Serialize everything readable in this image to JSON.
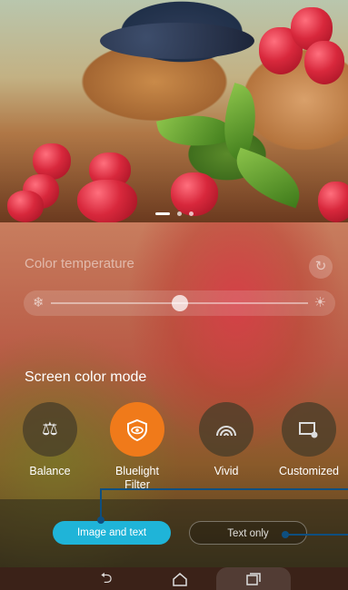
{
  "preview": {
    "icons": [
      "raspberry-photo",
      "page-indicator"
    ],
    "page_indicator_count": 3,
    "page_indicator_active": 0
  },
  "color_temperature": {
    "label": "Color temperature",
    "reset_icon": "refresh-icon",
    "cold_icon": "snowflake-icon",
    "warm_icon": "sun-icon",
    "slider_value": 0.5
  },
  "screen_color_mode": {
    "label": "Screen color mode",
    "modes": [
      {
        "label": "Balance",
        "icon": "balance-scale-icon",
        "selected": false
      },
      {
        "label": "Bluelight Filter",
        "icon": "eye-shield-icon",
        "selected": true
      },
      {
        "label": "Vivid",
        "icon": "rainbow-icon",
        "selected": false
      },
      {
        "label": "Customized",
        "icon": "custom-screen-icon",
        "selected": false
      }
    ]
  },
  "filter_options": {
    "active": "Image and text",
    "inactive": "Text only"
  },
  "colors": {
    "accent_orange": "#f07a1a",
    "accent_cyan": "#1fb4d8",
    "pointer": "#0e4f80"
  },
  "nav": {
    "back_icon": "back-icon",
    "home_icon": "home-icon",
    "recent_icon": "recent-apps-icon"
  }
}
